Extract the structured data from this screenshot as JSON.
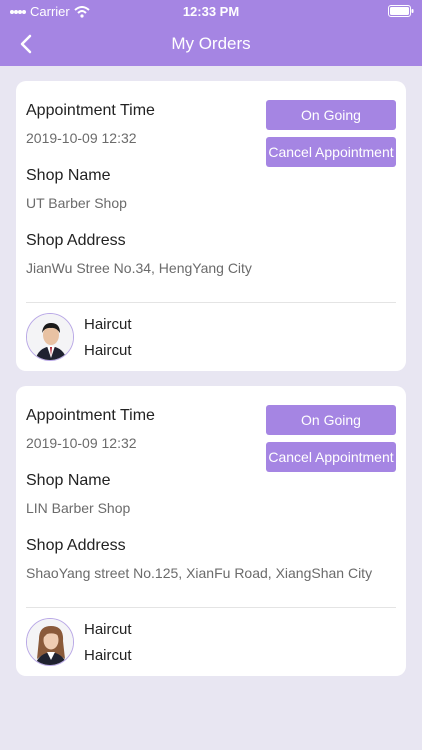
{
  "status_bar": {
    "carrier": "Carrier",
    "time": "12:33 PM"
  },
  "nav": {
    "title": "My Orders"
  },
  "orders": [
    {
      "appointment_time_label": "Appointment Time",
      "appointment_time": "2019-10-09 12:32",
      "shop_name_label": "Shop Name",
      "shop_name": "UT Barber Shop",
      "shop_address_label": "Shop Address",
      "shop_address": "JianWu Stree No.34, HengYang City",
      "status_button": "On Going",
      "cancel_button": "Cancel Appointment",
      "services": [
        "Haircut",
        "Haircut"
      ]
    },
    {
      "appointment_time_label": "Appointment Time",
      "appointment_time": "2019-10-09 12:32",
      "shop_name_label": "Shop Name",
      "shop_name": "LIN Barber Shop",
      "shop_address_label": "Shop Address",
      "shop_address": "ShaoYang street No.125, XianFu Road, XiangShan City",
      "status_button": "On Going",
      "cancel_button": "Cancel Appointment",
      "services": [
        "Haircut",
        "Haircut"
      ]
    }
  ],
  "colors": {
    "accent": "#a585e3",
    "background": "#e8e6f2"
  }
}
